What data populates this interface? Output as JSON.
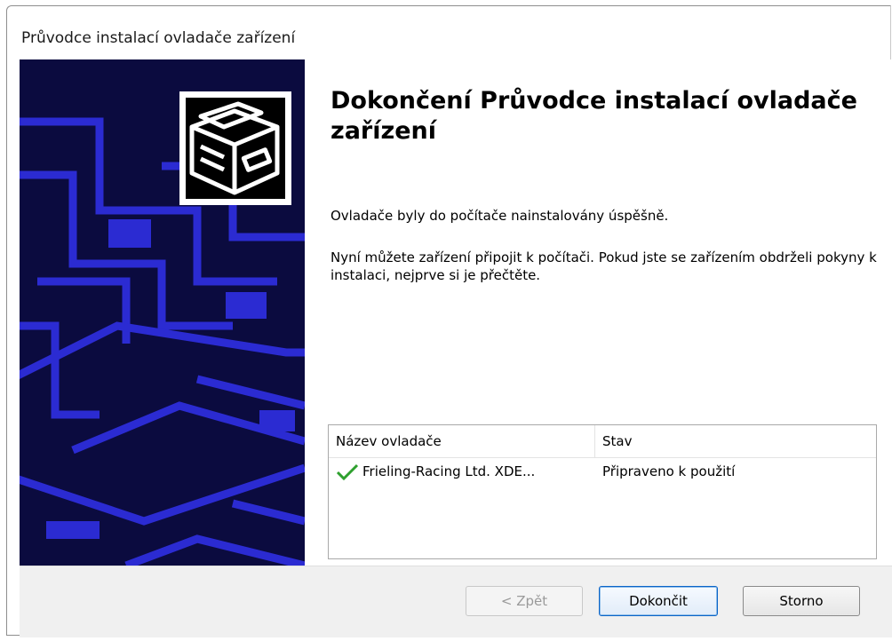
{
  "window": {
    "title": "Průvodce instalací ovladače zařízení"
  },
  "main": {
    "heading": "Dokončení Průvodce instalací ovladače zařízení",
    "paragraph_1": "Ovladače byly do počítače nainstalovány úspěšně.",
    "paragraph_2": "Nyní můžete zařízení připojit k počítači. Pokud jste se zařízením obdrželi pokyny k instalaci, nejprve si je přečtěte."
  },
  "driver_list": {
    "columns": [
      "Název ovladače",
      "Stav"
    ],
    "rows": [
      {
        "name": "Frieling-Racing Ltd. XDE...",
        "status": "Připraveno k použití",
        "icon": "check-icon"
      }
    ]
  },
  "buttons": {
    "back": "< Zpět",
    "finish": "Dokončit",
    "cancel": "Storno"
  },
  "colors": {
    "banner_background": "#0b0b3f",
    "banner_lines": "#2b2bd2",
    "check_green": "#2ea02e",
    "default_button_border": "#0a64c8",
    "footer_background": "#f0f0f0"
  }
}
